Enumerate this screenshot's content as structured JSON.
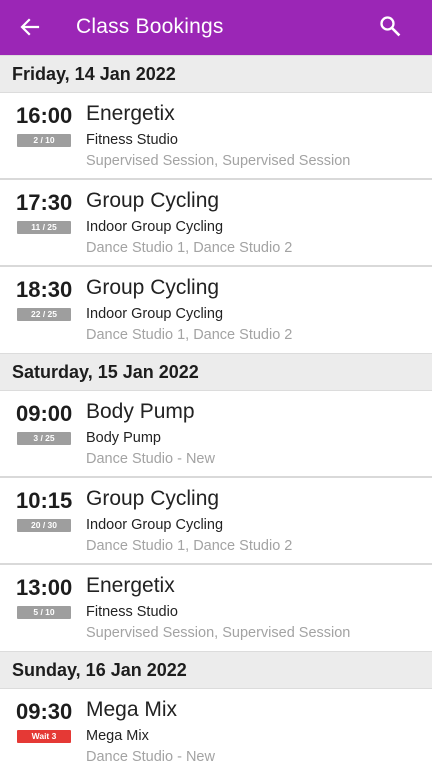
{
  "app_bar": {
    "title": "Class Bookings",
    "back_icon": "arrow-left-icon",
    "search_icon": "search-icon",
    "color": "#9b26b6"
  },
  "days": [
    {
      "date": "Friday, 14 Jan 2022",
      "sessions": [
        {
          "time": "16:00",
          "badge": "2 / 10",
          "badge_type": "capacity",
          "name": "Energetix",
          "location": "Fitness Studio",
          "rooms": "Supervised Session, Supervised Session"
        },
        {
          "time": "17:30",
          "badge": "11 / 25",
          "badge_type": "capacity",
          "name": "Group Cycling",
          "location": "Indoor Group Cycling",
          "rooms": "Dance Studio 1, Dance Studio 2"
        },
        {
          "time": "18:30",
          "badge": "22 / 25",
          "badge_type": "capacity",
          "name": "Group Cycling",
          "location": "Indoor Group Cycling",
          "rooms": "Dance Studio 1, Dance Studio 2"
        }
      ]
    },
    {
      "date": "Saturday, 15 Jan 2022",
      "sessions": [
        {
          "time": "09:00",
          "badge": "3 / 25",
          "badge_type": "capacity",
          "name": "Body Pump",
          "location": "Body Pump",
          "rooms": "Dance Studio - New"
        },
        {
          "time": "10:15",
          "badge": "20 / 30",
          "badge_type": "capacity",
          "name": "Group Cycling",
          "location": "Indoor Group Cycling",
          "rooms": "Dance Studio 1, Dance Studio 2"
        },
        {
          "time": "13:00",
          "badge": "5 / 10",
          "badge_type": "capacity",
          "name": "Energetix",
          "location": "Fitness Studio",
          "rooms": "Supervised Session, Supervised Session"
        }
      ]
    },
    {
      "date": "Sunday, 16 Jan 2022",
      "sessions": [
        {
          "time": "09:30",
          "badge": "Wait 3",
          "badge_type": "waitlist",
          "name": "Mega Mix",
          "location": "Mega Mix",
          "rooms": "Dance Studio - New"
        }
      ]
    }
  ]
}
